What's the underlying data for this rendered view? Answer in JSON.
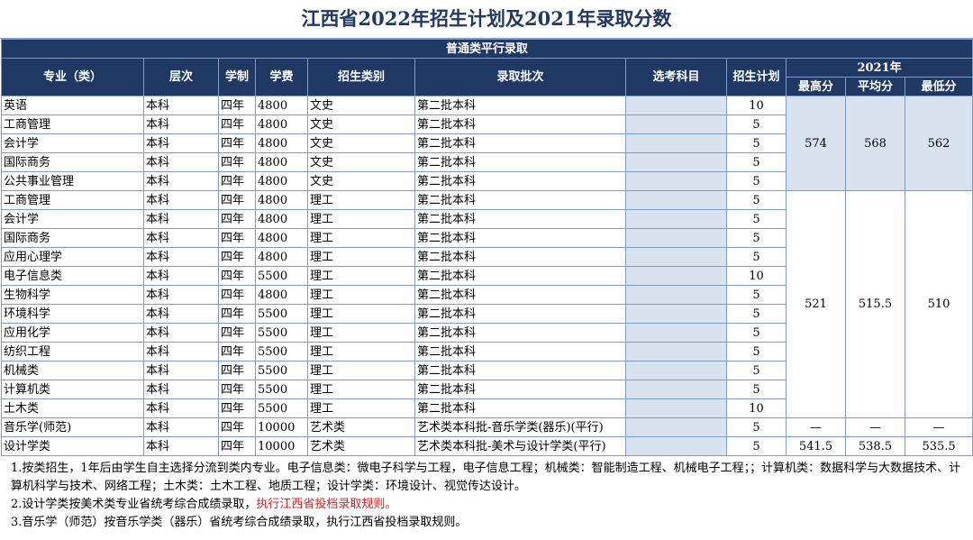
{
  "title": "江西省2022年招生计划及2021年录取分数",
  "section": "普通类平行录取",
  "headers": {
    "major": "专业（类）",
    "level": "层次",
    "duration": "学制",
    "fee": "学费",
    "category": "招生类别",
    "batch": "录取批次",
    "subjects": "选考科目",
    "plan": "招生计划",
    "year": "2021年",
    "max": "最高分",
    "avg": "平均分",
    "min": "最低分"
  },
  "rows": [
    {
      "major": "英语",
      "level": "本科",
      "duration": "四年",
      "fee": "4800",
      "category": "文史",
      "batch": "第二批本科",
      "subjects": "",
      "plan": "10"
    },
    {
      "major": "工商管理",
      "level": "本科",
      "duration": "四年",
      "fee": "4800",
      "category": "文史",
      "batch": "第二批本科",
      "subjects": "",
      "plan": "5"
    },
    {
      "major": "会计学",
      "level": "本科",
      "duration": "四年",
      "fee": "4800",
      "category": "文史",
      "batch": "第二批本科",
      "subjects": "",
      "plan": "5"
    },
    {
      "major": "国际商务",
      "level": "本科",
      "duration": "四年",
      "fee": "4800",
      "category": "文史",
      "batch": "第二批本科",
      "subjects": "",
      "plan": "5"
    },
    {
      "major": "公共事业管理",
      "level": "本科",
      "duration": "四年",
      "fee": "4800",
      "category": "文史",
      "batch": "第二批本科",
      "subjects": "",
      "plan": "5"
    },
    {
      "major": "工商管理",
      "level": "本科",
      "duration": "四年",
      "fee": "4800",
      "category": "理工",
      "batch": "第二批本科",
      "subjects": "",
      "plan": "5"
    },
    {
      "major": "会计学",
      "level": "本科",
      "duration": "四年",
      "fee": "4800",
      "category": "理工",
      "batch": "第二批本科",
      "subjects": "",
      "plan": "5"
    },
    {
      "major": "国际商务",
      "level": "本科",
      "duration": "四年",
      "fee": "4800",
      "category": "理工",
      "batch": "第二批本科",
      "subjects": "",
      "plan": "5"
    },
    {
      "major": "应用心理学",
      "level": "本科",
      "duration": "四年",
      "fee": "4800",
      "category": "理工",
      "batch": "第二批本科",
      "subjects": "",
      "plan": "5"
    },
    {
      "major": "电子信息类",
      "level": "本科",
      "duration": "四年",
      "fee": "5500",
      "category": "理工",
      "batch": "第二批本科",
      "subjects": "",
      "plan": "10"
    },
    {
      "major": "生物科学",
      "level": "本科",
      "duration": "四年",
      "fee": "4800",
      "category": "理工",
      "batch": "第二批本科",
      "subjects": "",
      "plan": "5"
    },
    {
      "major": "环境科学",
      "level": "本科",
      "duration": "四年",
      "fee": "5500",
      "category": "理工",
      "batch": "第二批本科",
      "subjects": "",
      "plan": "5"
    },
    {
      "major": "应用化学",
      "level": "本科",
      "duration": "四年",
      "fee": "5500",
      "category": "理工",
      "batch": "第二批本科",
      "subjects": "",
      "plan": "5"
    },
    {
      "major": "纺织工程",
      "level": "本科",
      "duration": "四年",
      "fee": "5500",
      "category": "理工",
      "batch": "第二批本科",
      "subjects": "",
      "plan": "5"
    },
    {
      "major": "机械类",
      "level": "本科",
      "duration": "四年",
      "fee": "5500",
      "category": "理工",
      "batch": "第二批本科",
      "subjects": "",
      "plan": "5"
    },
    {
      "major": "计算机类",
      "level": "本科",
      "duration": "四年",
      "fee": "5500",
      "category": "理工",
      "batch": "第二批本科",
      "subjects": "",
      "plan": "5"
    },
    {
      "major": "土木类",
      "level": "本科",
      "duration": "四年",
      "fee": "5500",
      "category": "理工",
      "batch": "第二批本科",
      "subjects": "",
      "plan": "10"
    },
    {
      "major": "音乐学(师范)",
      "level": "本科",
      "duration": "四年",
      "fee": "10000",
      "category": "艺术类",
      "batch": "艺术类本科批-音乐学类(器乐)(平行)",
      "subjects": "",
      "plan": "5"
    },
    {
      "major": "设计学类",
      "level": "本科",
      "duration": "四年",
      "fee": "10000",
      "category": "艺术类",
      "batch": "艺术类本科批-美术与设计学类(平行)",
      "subjects": "",
      "plan": "5"
    }
  ],
  "scores": {
    "wenshi": {
      "max": "574",
      "avg": "568",
      "min": "562"
    },
    "ligong": {
      "max": "521",
      "avg": "515.5",
      "min": "510"
    },
    "music": {
      "max": "—",
      "avg": "—",
      "min": "—"
    },
    "design": {
      "max": "541.5",
      "avg": "538.5",
      "min": "535.5"
    }
  },
  "notes": {
    "n1": "1.按类招生，1年后由学生自主选择分流到类内专业。电子信息类：微电子科学与工程，电子信息工程；机械类：智能制造工程、机械电子工程；；计算机类：数据科学与大数据技术、计算机科学与技术、网络工程；土木类：土木工程、地质工程；设计学类：环境设计、视觉传达设计。",
    "n2_a": "2.设计学类按美术类专业省统考综合成绩录取，",
    "n2_b": "执行江西省投档录取规则。",
    "n3": "3.音乐学（师范）按音乐学类（器乐）省统考综合成绩录取，执行江西省投档录取规则。"
  }
}
